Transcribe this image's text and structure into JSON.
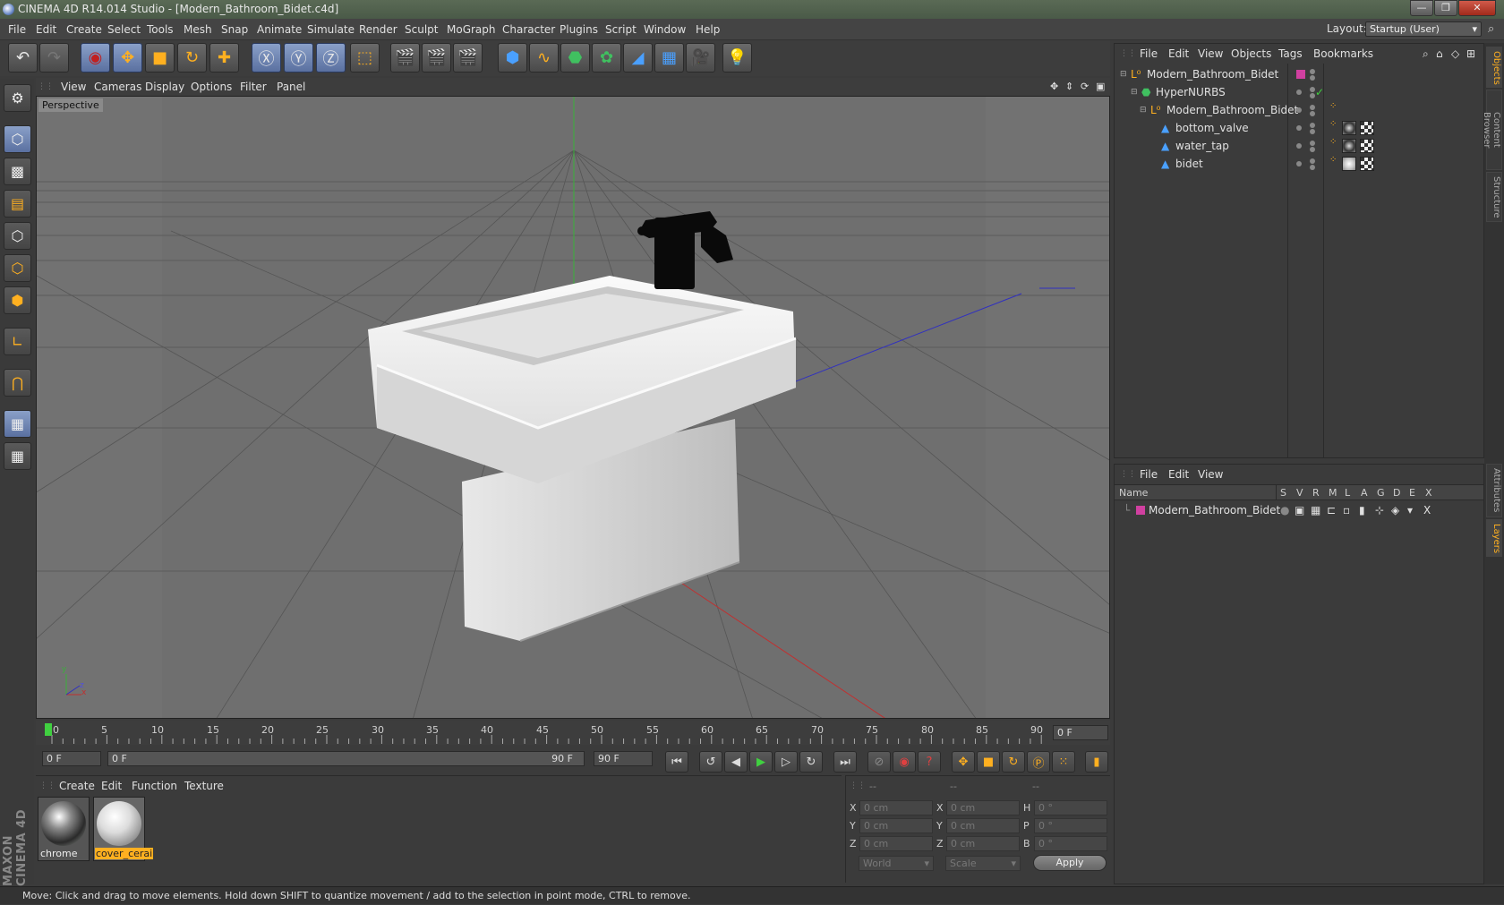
{
  "window": {
    "title": "CINEMA 4D R14.014 Studio - [Modern_Bathroom_Bidet.c4d]",
    "controls": [
      "—",
      "❐",
      "✕"
    ]
  },
  "menubar": {
    "items": [
      "File",
      "Edit",
      "Create",
      "Select",
      "Tools",
      "Mesh",
      "Snap",
      "Animate",
      "Simulate",
      "Render",
      "Sculpt",
      "MoGraph",
      "Character",
      "Plugins",
      "Script",
      "Window",
      "Help"
    ],
    "layout_label": "Layout:",
    "layout_value": "Startup (User)"
  },
  "viewport": {
    "menu": [
      "View",
      "Cameras",
      "Display",
      "Options",
      "Filter",
      "Panel"
    ],
    "label": "Perspective"
  },
  "timeline": {
    "ticks": [
      "0",
      "5",
      "10",
      "15",
      "20",
      "25",
      "30",
      "35",
      "40",
      "45",
      "50",
      "55",
      "60",
      "65",
      "70",
      "75",
      "80",
      "85",
      "90"
    ],
    "current_frame": "0 F",
    "start_field": "0 F",
    "range_start": "0 F",
    "range_end": "90 F",
    "end_field": "90 F"
  },
  "materials": {
    "menu": [
      "Create",
      "Edit",
      "Function",
      "Texture"
    ],
    "items": [
      {
        "name": "chrome",
        "selected": false
      },
      {
        "name": "cover_cerai",
        "selected": true
      }
    ]
  },
  "coords": {
    "headers": [
      "--",
      "--",
      "--"
    ],
    "rows": [
      {
        "a": "X",
        "av": "0 cm",
        "b": "X",
        "bv": "0 cm",
        "c": "H",
        "cv": "0 °"
      },
      {
        "a": "Y",
        "av": "0 cm",
        "b": "Y",
        "bv": "0 cm",
        "c": "P",
        "cv": "0 °"
      },
      {
        "a": "Z",
        "av": "0 cm",
        "b": "Z",
        "bv": "0 cm",
        "c": "B",
        "cv": "0 °"
      }
    ],
    "mode1": "World",
    "mode2": "Scale",
    "apply": "Apply"
  },
  "objects": {
    "menu": [
      "File",
      "Edit",
      "View",
      "Objects",
      "Tags",
      "Bookmarks"
    ],
    "rows": [
      {
        "name": "Modern_Bathroom_Bidet",
        "indent": 0,
        "icon": "null-icon"
      },
      {
        "name": "HyperNURBS",
        "indent": 1,
        "icon": "hypernurbs-icon"
      },
      {
        "name": "Modern_Bathroom_Bidet",
        "indent": 2,
        "icon": "null-icon"
      },
      {
        "name": "bottom_valve",
        "indent": 3,
        "icon": "polygon-icon"
      },
      {
        "name": "water_tap",
        "indent": 3,
        "icon": "polygon-icon"
      },
      {
        "name": "bidet",
        "indent": 3,
        "icon": "polygon-icon"
      }
    ]
  },
  "layers": {
    "menu": [
      "File",
      "Edit",
      "View"
    ],
    "header_name": "Name",
    "columns": [
      "S",
      "V",
      "R",
      "M",
      "L",
      "A",
      "G",
      "D",
      "E",
      "X"
    ],
    "rows": [
      {
        "name": "Modern_Bathroom_Bidet",
        "color": "#d040a0"
      }
    ]
  },
  "right_tabs": [
    "Objects",
    "Content Browser",
    "Structure",
    "Attributes",
    "Layers"
  ],
  "status": "Move: Click and drag to move elements. Hold down SHIFT to quantize movement / add to the selection in point mode, CTRL to remove.",
  "brand": "MAXON CINEMA 4D",
  "colors": {
    "accent": "#ffb020",
    "selection": "#8aa0c8",
    "layer": "#d040a0"
  }
}
